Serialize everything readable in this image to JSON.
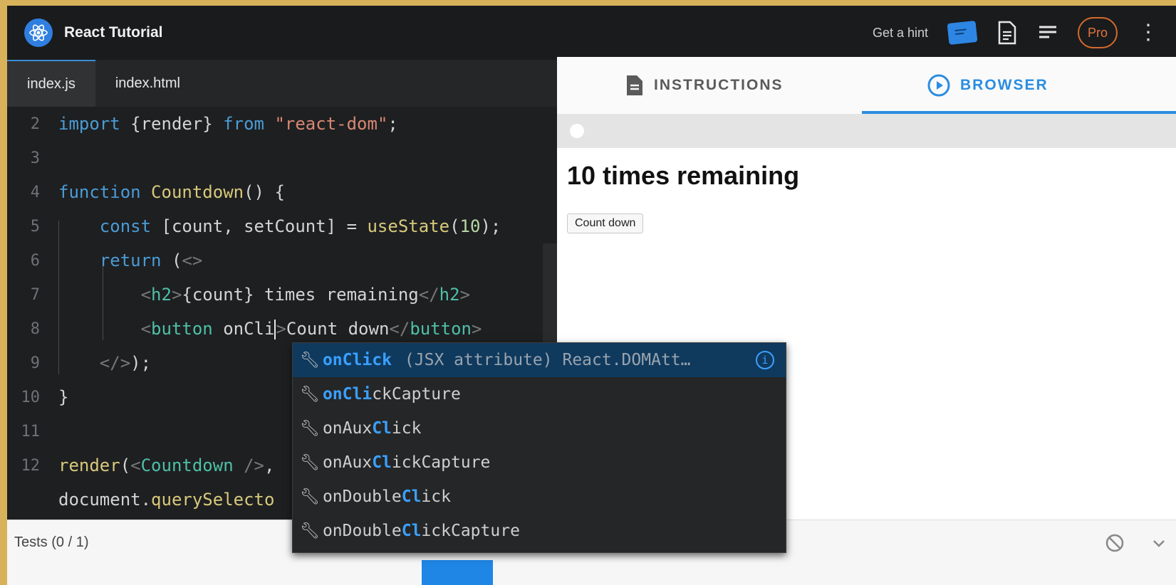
{
  "header": {
    "title": "React Tutorial",
    "hint_label": "Get a hint",
    "pro_label": "Pro"
  },
  "editor": {
    "tabs": [
      "index.js",
      "index.html"
    ],
    "lines": [
      {
        "n": "2"
      },
      {
        "n": "3"
      },
      {
        "n": "4"
      },
      {
        "n": "5"
      },
      {
        "n": "6"
      },
      {
        "n": "7"
      },
      {
        "n": "8"
      },
      {
        "n": "9"
      },
      {
        "n": "10"
      },
      {
        "n": "11"
      },
      {
        "n": "12"
      }
    ]
  },
  "autocomplete": {
    "items": [
      {
        "parts": [
          "on",
          "Cl",
          "i",
          "c",
          "k"
        ],
        "detail": "(JSX attribute) React.DOMAtt…",
        "selected": true
      },
      {
        "parts": [
          "on",
          "Cl",
          "i",
          "c",
          "kCapture"
        ],
        "detail": ""
      },
      {
        "parts": [
          "onAux",
          "Cl",
          "i",
          "c",
          "k"
        ],
        "detail": ""
      },
      {
        "parts": [
          "onAux",
          "Cl",
          "i",
          "c",
          "kCapture"
        ],
        "detail": ""
      },
      {
        "parts": [
          "onDouble",
          "Cl",
          "i",
          "c",
          "k"
        ],
        "detail": ""
      },
      {
        "parts": [
          "onDouble",
          "Cl",
          "i",
          "c",
          "kCapture"
        ],
        "detail": ""
      }
    ]
  },
  "right_panel": {
    "tabs": [
      "INSTRUCTIONS",
      "BROWSER"
    ],
    "active_tab": "BROWSER",
    "preview_heading": "10 times remaining",
    "preview_button": "Count down"
  },
  "footer": {
    "tests_label": "Tests (0 / 1)"
  },
  "colors": {
    "accent": "#2a8de0",
    "pro": "#d46a2a",
    "editor_bg": "#1e1f21"
  }
}
